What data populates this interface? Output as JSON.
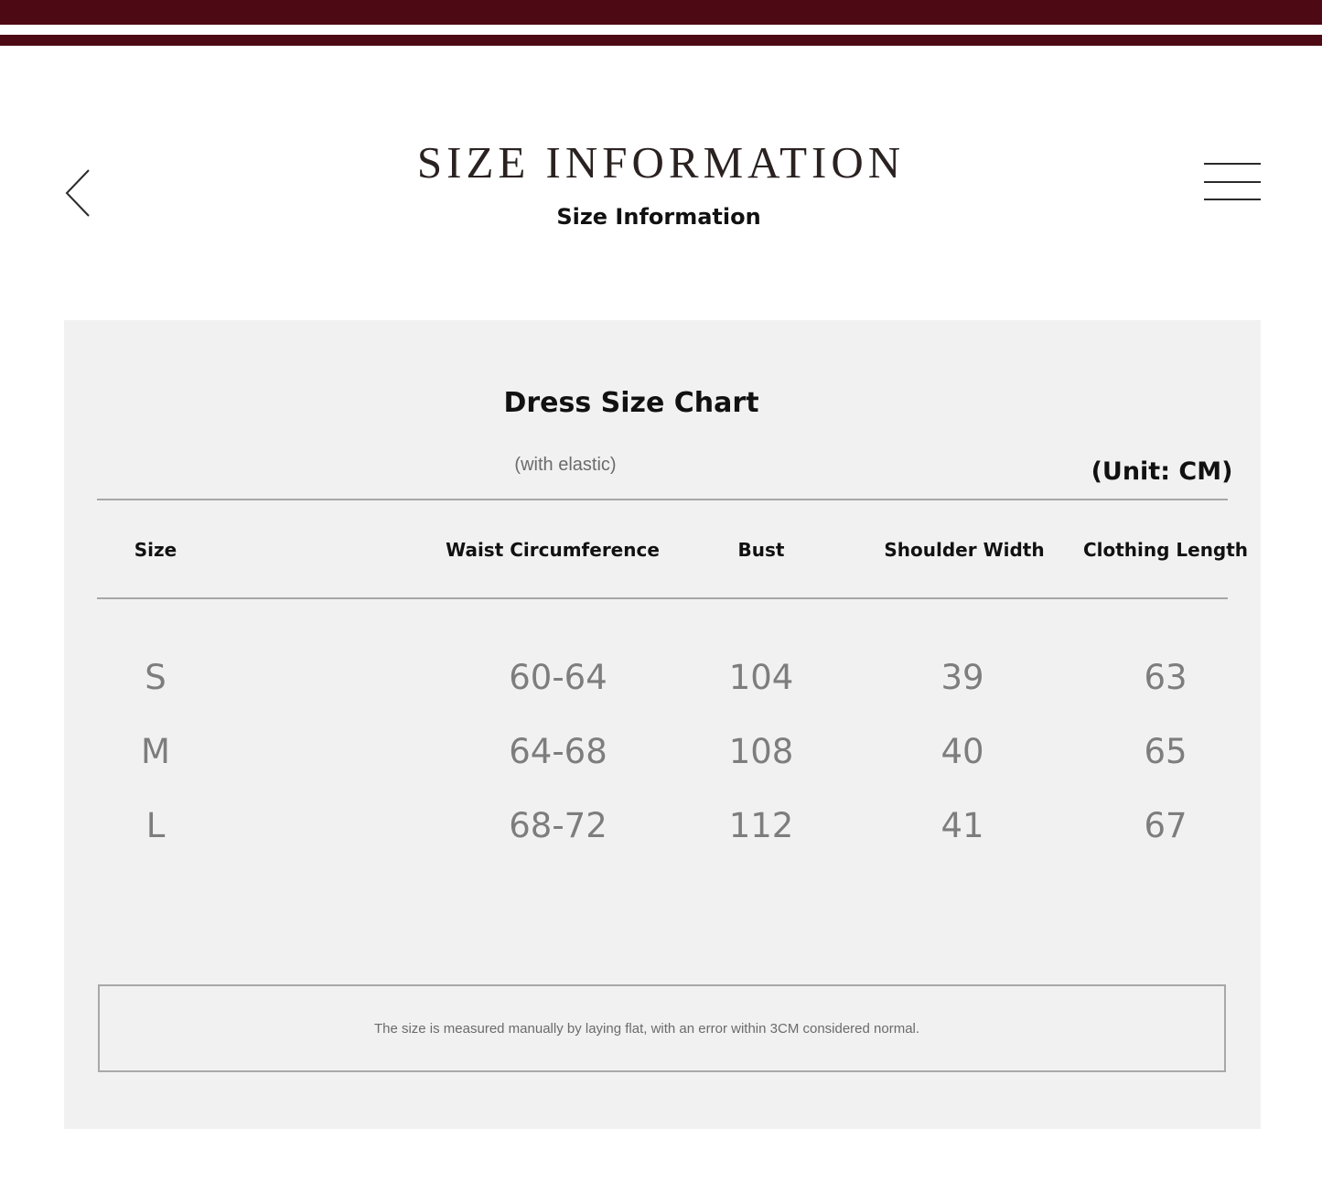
{
  "colors": {
    "band": "#4e0a14",
    "panel": "#f1f1f1",
    "rule": "#a7a7a7"
  },
  "header": {
    "back_icon": "chevron-left-icon",
    "menu_icon": "hamburger-menu-icon",
    "title": "SIZE INFORMATION",
    "subtitle": "Size Information"
  },
  "chart": {
    "title": "Dress Size Chart",
    "note": "(with elastic)",
    "unit": "(Unit: CM)",
    "columns": [
      "Size",
      "Waist Circumference",
      "Bust",
      "Shoulder Width",
      "Clothing Length"
    ],
    "rows": [
      [
        "S",
        "60-64",
        "104",
        "39",
        "63"
      ],
      [
        "M",
        "64-68",
        "108",
        "40",
        "65"
      ],
      [
        "L",
        "68-72",
        "112",
        "41",
        "67"
      ]
    ]
  },
  "footer": {
    "disclaimer": "The size is measured manually by laying flat, with an error within 3CM considered normal."
  }
}
